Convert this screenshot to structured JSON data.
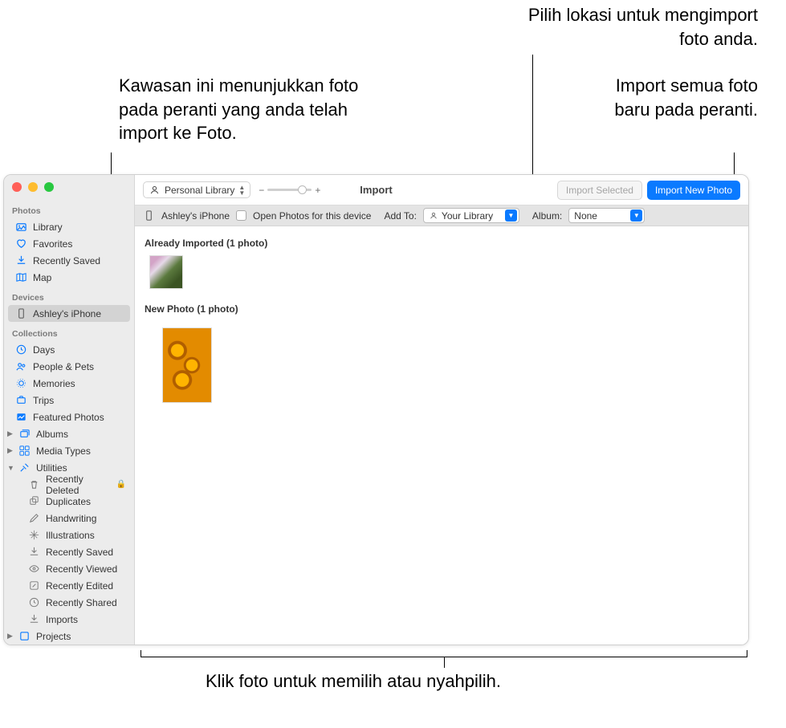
{
  "callouts": {
    "top_right_1": "Pilih lokasi untuk mengimport foto anda.",
    "top_left": "Kawasan ini menunjukkan foto pada peranti yang anda telah import ke Foto.",
    "top_right_2": "Import semua foto baru pada peranti.",
    "bottom": "Klik foto untuk memilih atau nyahpilih."
  },
  "toolbar": {
    "library": "Personal Library",
    "title": "Import",
    "import_selected": "Import Selected",
    "import_new": "Import New Photo"
  },
  "devbar": {
    "device": "Ashley's iPhone",
    "open_photos": "Open Photos for this device",
    "add_to": "Add To:",
    "add_to_value": "Your Library",
    "album": "Album:",
    "album_value": "None"
  },
  "sections": {
    "already": "Already Imported (1 photo)",
    "new": "New Photo (1 photo)"
  },
  "sidebar": {
    "headers": {
      "photos": "Photos",
      "devices": "Devices",
      "collections": "Collections"
    },
    "items": {
      "library": "Library",
      "favorites": "Favorites",
      "recently_saved": "Recently Saved",
      "map": "Map",
      "device": "Ashley's iPhone",
      "days": "Days",
      "people": "People & Pets",
      "memories": "Memories",
      "trips": "Trips",
      "featured": "Featured Photos",
      "albums": "Albums",
      "media": "Media Types",
      "utilities": "Utilities",
      "recently_deleted": "Recently Deleted",
      "duplicates": "Duplicates",
      "handwriting": "Handwriting",
      "illustrations": "Illustrations",
      "recently_saved2": "Recently Saved",
      "recently_viewed": "Recently Viewed",
      "recently_edited": "Recently Edited",
      "recently_shared": "Recently Shared",
      "imports": "Imports",
      "projects": "Projects"
    }
  }
}
